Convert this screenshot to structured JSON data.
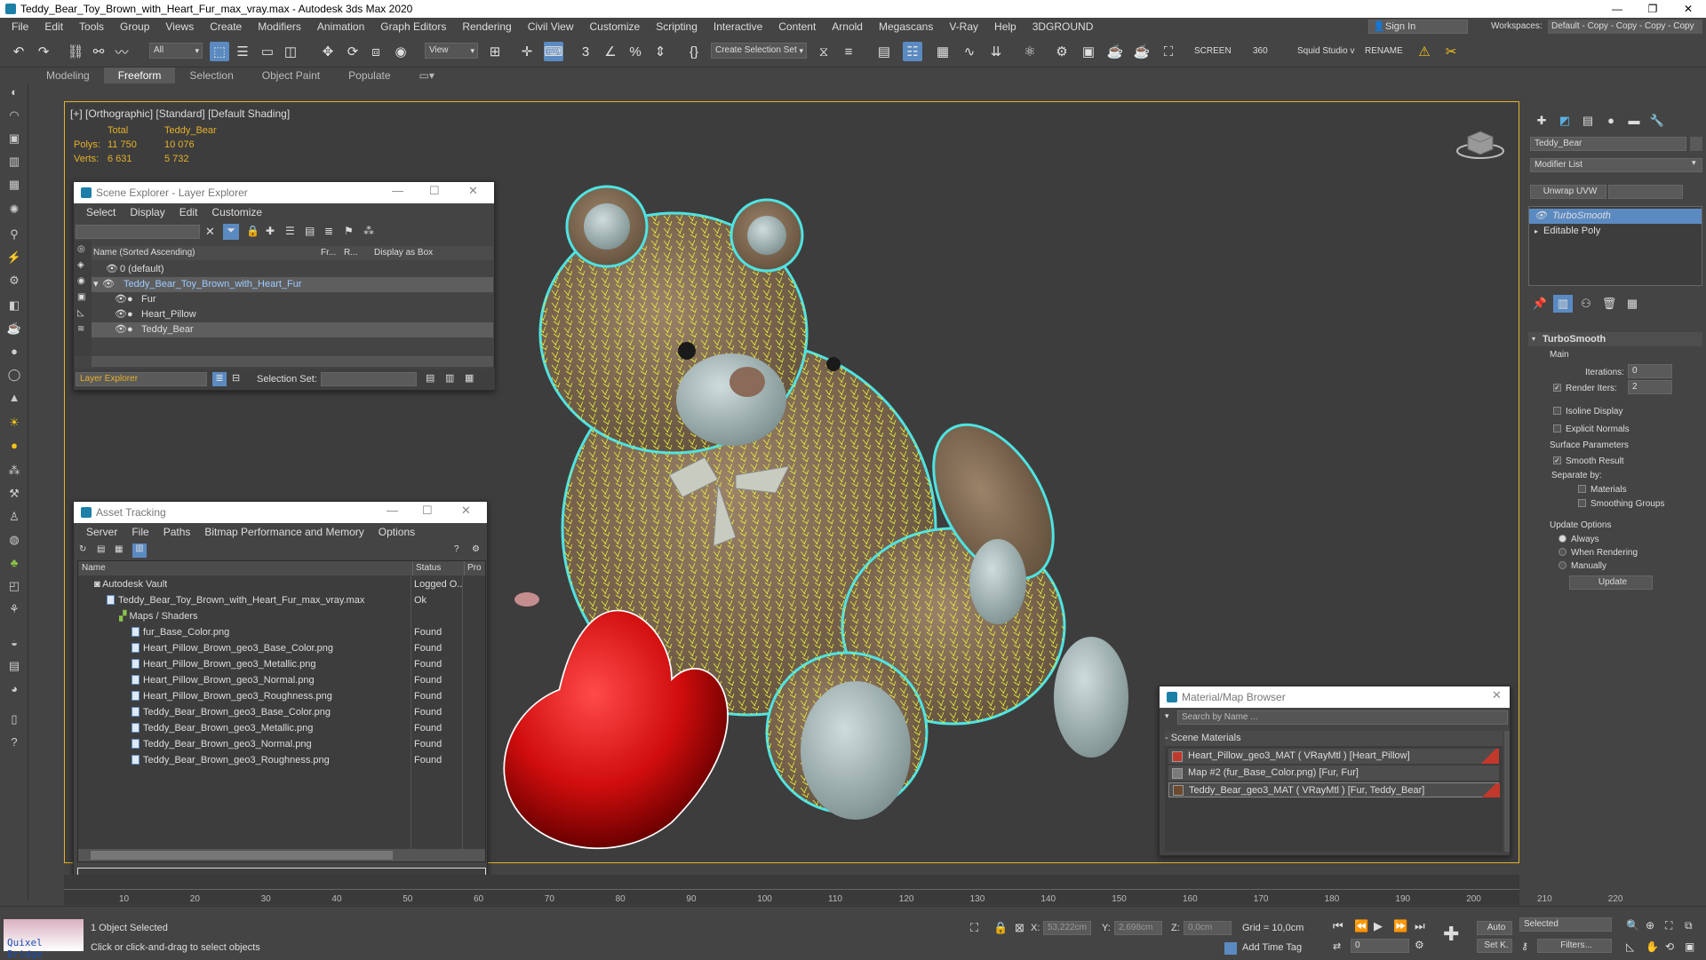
{
  "window": {
    "title": "Teddy_Bear_Toy_Brown_with_Heart_Fur_max_vray.max - Autodesk 3ds Max 2020"
  },
  "menu": [
    "File",
    "Edit",
    "Tools",
    "Group",
    "Views",
    "Create",
    "Modifiers",
    "Animation",
    "Graph Editors",
    "Rendering",
    "Civil View",
    "Customize",
    "Scripting",
    "Interactive",
    "Content",
    "Arnold",
    "Megascans",
    "V-Ray",
    "Help",
    "3DGROUND"
  ],
  "signin": {
    "label": "Sign In"
  },
  "workspace": {
    "label": "Workspaces:",
    "value": "Default - Copy - Copy - Copy - Copy"
  },
  "toolbar": {
    "filter": "All",
    "view": "View",
    "selection_set": "Create Selection Set",
    "screen": "SCREEN",
    "num": "360",
    "studio": "Squid Studio v",
    "rename": "RENAME"
  },
  "ribbon": {
    "tabs": [
      "Modeling",
      "Freeform",
      "Selection",
      "Object Paint",
      "Populate"
    ]
  },
  "viewport": {
    "label": "[+] [Orthographic] [Standard] [Default Shading]",
    "stats": {
      "col_total": "Total",
      "col_obj": "Teddy_Bear",
      "polys_label": "Polys:",
      "polys_total": "11 750",
      "polys_obj": "10 076",
      "verts_label": "Verts:",
      "verts_total": "6 631",
      "verts_obj": "5 732"
    }
  },
  "scene_explorer": {
    "title": "Scene Explorer - Layer Explorer",
    "menu": [
      "Select",
      "Display",
      "Edit",
      "Customize"
    ],
    "headers": {
      "name": "Name (Sorted Ascending)",
      "fr": "Fr...",
      "r": "R...",
      "box": "Display as Box"
    },
    "rows": [
      {
        "name": "0 (default)"
      },
      {
        "name": "Teddy_Bear_Toy_Brown_with_Heart_Fur"
      },
      {
        "name": "Fur"
      },
      {
        "name": "Heart_Pillow"
      },
      {
        "name": "Teddy_Bear"
      }
    ],
    "footer": {
      "explorer": "Layer Explorer",
      "selset_label": "Selection Set:"
    }
  },
  "asset_tracking": {
    "title": "Asset Tracking",
    "menu": [
      "Server",
      "File",
      "Paths",
      "Bitmap Performance and Memory",
      "Options"
    ],
    "headers": {
      "name": "Name",
      "status": "Status",
      "pro": "Pro"
    },
    "rows": [
      {
        "name": "Autodesk Vault",
        "status": "Logged O..."
      },
      {
        "name": "Teddy_Bear_Toy_Brown_with_Heart_Fur_max_vray.max",
        "status": "Ok"
      },
      {
        "name": "Maps / Shaders",
        "status": ""
      },
      {
        "name": "fur_Base_Color.png",
        "status": "Found"
      },
      {
        "name": "Heart_Pillow_Brown_geo3_Base_Color.png",
        "status": "Found"
      },
      {
        "name": "Heart_Pillow_Brown_geo3_Metallic.png",
        "status": "Found"
      },
      {
        "name": "Heart_Pillow_Brown_geo3_Normal.png",
        "status": "Found"
      },
      {
        "name": "Heart_Pillow_Brown_geo3_Roughness.png",
        "status": "Found"
      },
      {
        "name": "Teddy_Bear_Brown_geo3_Base_Color.png",
        "status": "Found"
      },
      {
        "name": "Teddy_Bear_Brown_geo3_Metallic.png",
        "status": "Found"
      },
      {
        "name": "Teddy_Bear_Brown_geo3_Normal.png",
        "status": "Found"
      },
      {
        "name": "Teddy_Bear_Brown_geo3_Roughness.png",
        "status": "Found"
      }
    ]
  },
  "material_browser": {
    "title": "Material/Map Browser",
    "search_placeholder": "Search by Name ...",
    "section": "Scene Materials",
    "items": [
      {
        "label": "Heart_Pillow_geo3_MAT  ( VRayMtl )  [Heart_Pillow]",
        "color": "#c0392b"
      },
      {
        "label": "Map #2 (fur_Base_Color.png)  [Fur, Fur]",
        "color": "#7a7a7a"
      },
      {
        "label": "Teddy_Bear_geo3_MAT  ( VRayMtl )  [Fur, Teddy_Bear]",
        "color": "#6b4a2e"
      }
    ]
  },
  "command_panel": {
    "object_name": "Teddy_Bear",
    "modifier_list": "Modifier List",
    "unwrap": "Unwrap UVW",
    "stack": [
      "TurboSmooth",
      "Editable Poly"
    ],
    "rollout": {
      "title": "TurboSmooth",
      "main": "Main",
      "iterations_label": "Iterations:",
      "iterations": "0",
      "render_iters_label": "Render Iters:",
      "render_iters": "2",
      "isoline": "Isoline Display",
      "explicit": "Explicit Normals",
      "surface": "Surface Parameters",
      "smooth": "Smooth Result",
      "separate": "Separate by:",
      "materials": "Materials",
      "smoothing": "Smoothing Groups",
      "update_opts": "Update Options",
      "always": "Always",
      "when_rendering": "When Rendering",
      "manually": "Manually",
      "update_btn": "Update"
    }
  },
  "timeline": {
    "ticks": [
      "10",
      "20",
      "30",
      "40",
      "50",
      "60",
      "70",
      "80",
      "90",
      "100",
      "110",
      "120",
      "130",
      "140",
      "150",
      "160",
      "170",
      "180",
      "190",
      "200",
      "210",
      "220"
    ]
  },
  "status": {
    "selected": "1 Object Selected",
    "prompt": "Click or click-and-drag to select objects",
    "quixel": "Quixel Bridge",
    "x_label": "X:",
    "x": "53,222cm",
    "y_label": "Y:",
    "y": "2,698cm",
    "z_label": "Z:",
    "z": "0,0cm",
    "grid": "Grid = 10,0cm",
    "add_time_tag": "Add Time Tag",
    "auto": "Auto",
    "selected_dd": "Selected",
    "setk": "Set K.",
    "filters": "Filters...",
    "frame": "0"
  }
}
